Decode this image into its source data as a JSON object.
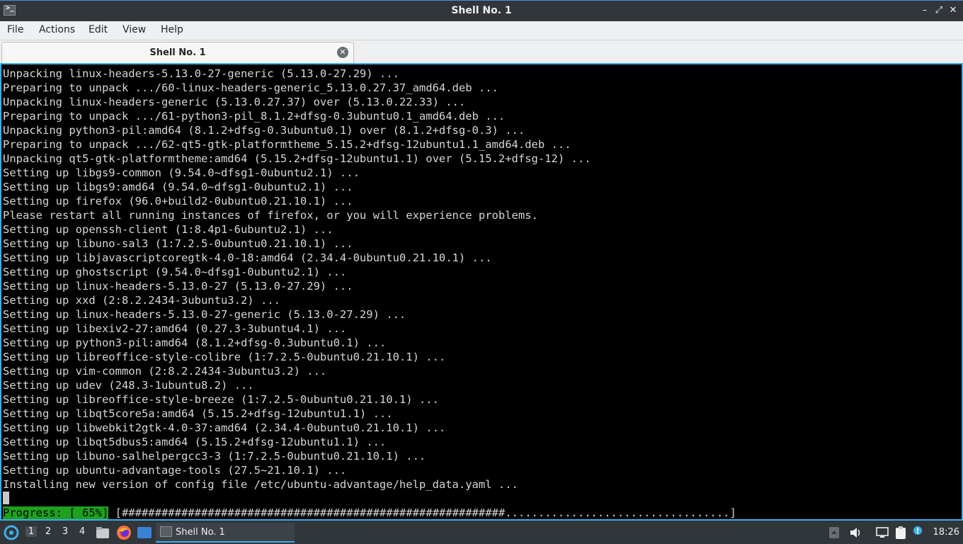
{
  "window": {
    "title": "Shell No. 1",
    "minimize_glyph": "–",
    "maximize_glyph": "⤢",
    "close_glyph": "✕"
  },
  "menu": [
    "File",
    "Actions",
    "Edit",
    "View",
    "Help"
  ],
  "tab": {
    "label": "Shell No. 1",
    "close_glyph": "✕"
  },
  "terminal": {
    "lines": [
      "Unpacking linux-headers-5.13.0-27-generic (5.13.0-27.29) ...",
      "Preparing to unpack .../60-linux-headers-generic_5.13.0.27.37_amd64.deb ...",
      "Unpacking linux-headers-generic (5.13.0.27.37) over (5.13.0.22.33) ...",
      "Preparing to unpack .../61-python3-pil_8.1.2+dfsg-0.3ubuntu0.1_amd64.deb ...",
      "Unpacking python3-pil:amd64 (8.1.2+dfsg-0.3ubuntu0.1) over (8.1.2+dfsg-0.3) ...",
      "Preparing to unpack .../62-qt5-gtk-platformtheme_5.15.2+dfsg-12ubuntu1.1_amd64.deb ...",
      "Unpacking qt5-gtk-platformtheme:amd64 (5.15.2+dfsg-12ubuntu1.1) over (5.15.2+dfsg-12) ...",
      "Setting up libgs9-common (9.54.0~dfsg1-0ubuntu2.1) ...",
      "Setting up libgs9:amd64 (9.54.0~dfsg1-0ubuntu2.1) ...",
      "Setting up firefox (96.0+build2-0ubuntu0.21.10.1) ...",
      "Please restart all running instances of firefox, or you will experience problems.",
      "Setting up openssh-client (1:8.4p1-6ubuntu2.1) ...",
      "Setting up libuno-sal3 (1:7.2.5-0ubuntu0.21.10.1) ...",
      "Setting up libjavascriptcoregtk-4.0-18:amd64 (2.34.4-0ubuntu0.21.10.1) ...",
      "Setting up ghostscript (9.54.0~dfsg1-0ubuntu2.1) ...",
      "Setting up linux-headers-5.13.0-27 (5.13.0-27.29) ...",
      "Setting up xxd (2:8.2.2434-3ubuntu3.2) ...",
      "Setting up linux-headers-5.13.0-27-generic (5.13.0-27.29) ...",
      "Setting up libexiv2-27:amd64 (0.27.3-3ubuntu4.1) ...",
      "Setting up python3-pil:amd64 (8.1.2+dfsg-0.3ubuntu0.1) ...",
      "Setting up libreoffice-style-colibre (1:7.2.5-0ubuntu0.21.10.1) ...",
      "Setting up vim-common (2:8.2.2434-3ubuntu3.2) ...",
      "Setting up udev (248.3-1ubuntu8.2) ...",
      "Setting up libreoffice-style-breeze (1:7.2.5-0ubuntu0.21.10.1) ...",
      "Setting up libqt5core5a:amd64 (5.15.2+dfsg-12ubuntu1.1) ...",
      "Setting up libwebkit2gtk-4.0-37:amd64 (2.34.4-0ubuntu0.21.10.1) ...",
      "Setting up libqt5dbus5:amd64 (5.15.2+dfsg-12ubuntu1.1) ...",
      "Setting up libuno-salhelpergcc3-3 (1:7.2.5-0ubuntu0.21.10.1) ...",
      "Setting up ubuntu-advantage-tools (27.5~21.10.1) ...",
      "Installing new version of config file /etc/ubuntu-advantage/help_data.yaml ..."
    ],
    "progress_label": "Progress: [ 65%]",
    "progress_bar": " [##########################################################..................................]",
    "progress_percent": 65,
    "progress_color": "#1ea21e"
  },
  "taskbar": {
    "workspaces": [
      "1",
      "2",
      "3",
      "4"
    ],
    "active_workspace": "1",
    "task_label": "Shell No. 1",
    "clock": "18:26",
    "accent": "#3daee9"
  }
}
